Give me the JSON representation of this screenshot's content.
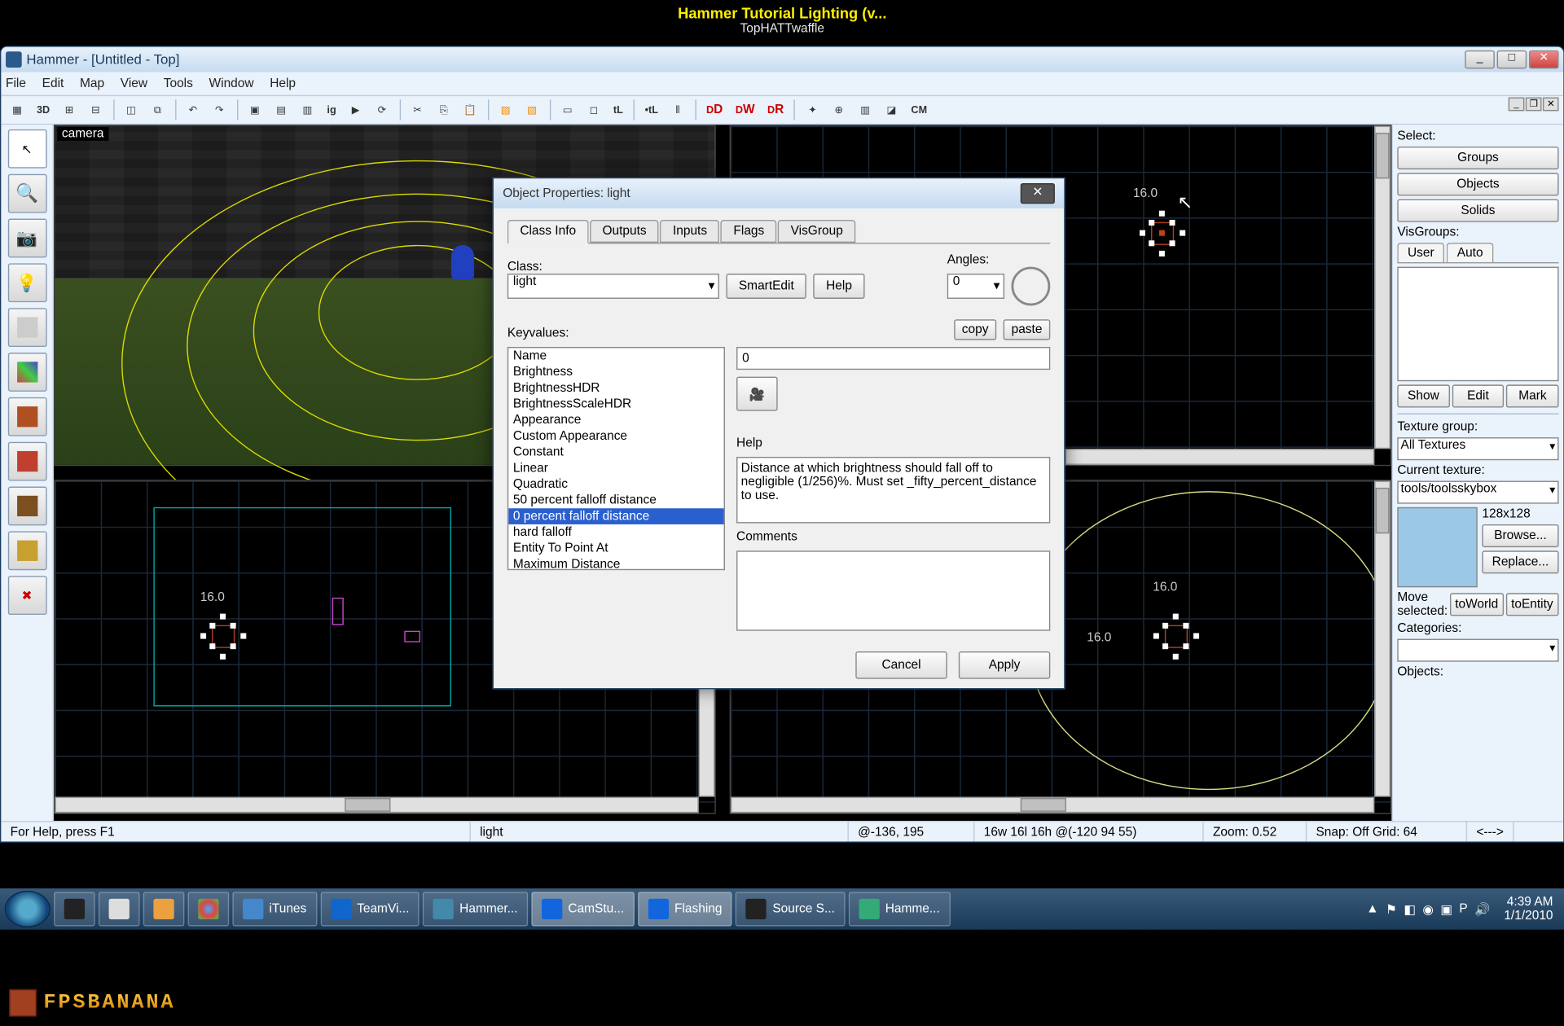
{
  "banner": {
    "title": "Hammer Tutorial Lighting (v...",
    "author": "TopHATTwaffle"
  },
  "window": {
    "title": "Hammer - [Untitled - Top]"
  },
  "menus": [
    "File",
    "Edit",
    "Map",
    "View",
    "Tools",
    "Window",
    "Help"
  ],
  "toolbar_text": [
    "ig",
    "CM"
  ],
  "viewport": {
    "camera_label": "camera",
    "size_tr": "16.0",
    "size_br1": "16.0",
    "size_br2": "16.0",
    "size_bl": "16.0"
  },
  "dialog": {
    "title": "Object Properties: light",
    "tabs": [
      "Class Info",
      "Outputs",
      "Inputs",
      "Flags",
      "VisGroup"
    ],
    "class_label": "Class:",
    "class_value": "light",
    "smartedit": "SmartEdit",
    "help_btn": "Help",
    "angles_label": "Angles:",
    "angles_value": "0",
    "keyvalues_label": "Keyvalues:",
    "copy": "copy",
    "paste": "paste",
    "keys": [
      "Name",
      "Brightness",
      "BrightnessHDR",
      "BrightnessScaleHDR",
      "Appearance",
      "Custom Appearance",
      "Constant",
      "Linear",
      "Quadratic",
      "50 percent falloff distance",
      "0 percent falloff distance",
      "hard falloff",
      "Entity To Point At",
      "Maximum Distance"
    ],
    "selected_key_index": 10,
    "value_field": "0",
    "help_label": "Help",
    "help_text": "Distance at which brightness should fall off to negligible (1/256)%. Must set _fifty_percent_distance to use.",
    "comments_label": "Comments",
    "cancel": "Cancel",
    "apply": "Apply"
  },
  "right": {
    "select_label": "Select:",
    "groups": "Groups",
    "objects": "Objects",
    "solids": "Solids",
    "visgroups_label": "VisGroups:",
    "tab_user": "User",
    "tab_auto": "Auto",
    "show": "Show",
    "edit": "Edit",
    "mark": "Mark",
    "texgroup_label": "Texture group:",
    "texgroup_value": "All Textures",
    "curtex_label": "Current texture:",
    "curtex_value": "tools/toolsskybox",
    "texsize": "128x128",
    "browse": "Browse...",
    "replace": "Replace...",
    "move_label": "Move selected:",
    "toworld": "toWorld",
    "toentity": "toEntity",
    "categories_label": "Categories:",
    "objects_label": "Objects:"
  },
  "status": {
    "help": "For Help, press F1",
    "entity": "light",
    "coords": "@-136, 195",
    "dims": "16w 16l 16h @(-120 94 55)",
    "zoom": "Zoom: 0.52",
    "snap": "Snap: Off Grid: 64",
    "last": "<--->"
  },
  "taskbar": {
    "items": [
      "",
      "",
      "",
      "",
      "iTunes",
      "TeamVi...",
      "Hammer...",
      "CamStu...",
      "Flashing",
      "Source S...",
      "Hamme..."
    ],
    "time": "4:39 AM",
    "date": "1/1/2010"
  },
  "watermark": "FPSBANANA"
}
